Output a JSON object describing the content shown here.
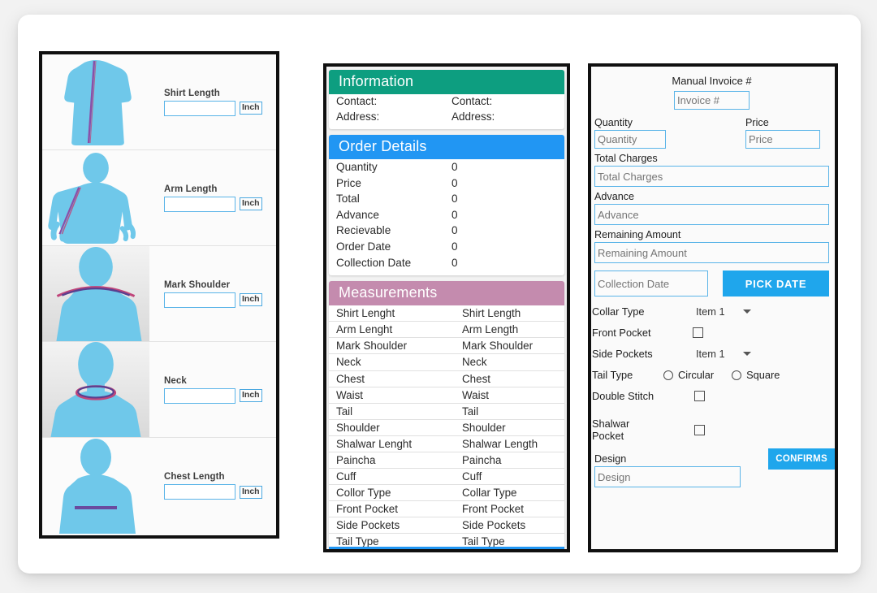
{
  "measurement_panel": {
    "unit_label": "Inch",
    "rows": [
      {
        "label": "Shirt Length",
        "value": "",
        "figure": "kurta-figure-icon",
        "shaded": false
      },
      {
        "label": "Arm Length",
        "value": "",
        "figure": "body-arm-figure-icon",
        "shaded": false
      },
      {
        "label": "Mark Shoulder",
        "value": "",
        "figure": "shoulder-figure-icon",
        "shaded": true
      },
      {
        "label": "Neck",
        "value": "",
        "figure": "neck-figure-icon",
        "shaded": true
      },
      {
        "label": "Chest Length",
        "value": "",
        "figure": "chest-figure-icon",
        "shaded": false
      }
    ]
  },
  "summary_panel": {
    "information": {
      "title": "Information",
      "rows": [
        {
          "key": "Contact:",
          "value": "Contact:"
        },
        {
          "key": "Address:",
          "value": "Address:"
        }
      ]
    },
    "order_details": {
      "title": "Order Details",
      "rows": [
        {
          "key": "Quantity",
          "value": "0"
        },
        {
          "key": "Price",
          "value": "0"
        },
        {
          "key": "Total",
          "value": "0"
        },
        {
          "key": "Advance",
          "value": "0"
        },
        {
          "key": "Recievable",
          "value": "0"
        },
        {
          "key": "Order Date",
          "value": "0"
        },
        {
          "key": "Collection Date",
          "value": "0"
        }
      ]
    },
    "measurements": {
      "title": "Measurements",
      "rows": [
        {
          "key": "Shirt Lenght",
          "value": "Shirt Length"
        },
        {
          "key": "Arm Lenght",
          "value": "Arm Length"
        },
        {
          "key": "Mark Shoulder",
          "value": "Mark Shoulder"
        },
        {
          "key": "Neck",
          "value": "Neck"
        },
        {
          "key": "Chest",
          "value": "Chest"
        },
        {
          "key": "Waist",
          "value": "Waist"
        },
        {
          "key": "Tail",
          "value": "Tail"
        },
        {
          "key": "Shoulder",
          "value": "Shoulder"
        },
        {
          "key": "Shalwar Lenght",
          "value": "Shalwar Length"
        },
        {
          "key": "Paincha",
          "value": "Paincha"
        },
        {
          "key": "Cuff",
          "value": "Cuff"
        },
        {
          "key": "Collor Type",
          "value": "Collar Type"
        },
        {
          "key": "Front Pocket",
          "value": "Front Pocket"
        },
        {
          "key": "Side Pockets",
          "value": "Side Pockets"
        },
        {
          "key": "Tail Type",
          "value": "Tail Type"
        }
      ]
    }
  },
  "order_form": {
    "manual_invoice_title": "Manual Invoice #",
    "invoice": {
      "value": "",
      "placeholder": "Invoice #"
    },
    "quantity": {
      "label": "Quantity",
      "value": "",
      "placeholder": "Quantity"
    },
    "price": {
      "label": "Price",
      "value": "",
      "placeholder": "Price"
    },
    "total_charges": {
      "label": "Total Charges",
      "value": "",
      "placeholder": "Total Charges"
    },
    "advance": {
      "label": "Advance",
      "value": "",
      "placeholder": "Advance"
    },
    "remaining_amount": {
      "label": "Remaining Amount",
      "value": "",
      "placeholder": "Remaining Amount"
    },
    "collection_date": {
      "value": "",
      "placeholder": "Collection Date"
    },
    "pick_date_button": "PICK DATE",
    "collar_type": {
      "label": "Collar Type",
      "selected": "Item 1"
    },
    "front_pocket": {
      "label": "Front Pocket",
      "checked": false
    },
    "side_pockets": {
      "label": "Side Pockets",
      "selected": "Item 1"
    },
    "tail_type": {
      "label": "Tail Type",
      "options": [
        "Circular",
        "Square"
      ],
      "selected": ""
    },
    "double_stitch": {
      "label": "Double Stitch",
      "checked": false
    },
    "shalwar_pocket": {
      "label": "Shalwar Pocket",
      "checked": false
    },
    "design": {
      "label": "Design",
      "value": "",
      "placeholder": "Design"
    },
    "confirm_button": "CONFIRMS"
  },
  "colors": {
    "information_header": "#0d9e80",
    "order_header": "#2196f3",
    "measurements_header": "#c48bae",
    "accent_button": "#1fa6ec",
    "input_border": "#5ab4e8",
    "figure_blue": "#6fc8ea",
    "measure_line": "#8a4fa8"
  }
}
